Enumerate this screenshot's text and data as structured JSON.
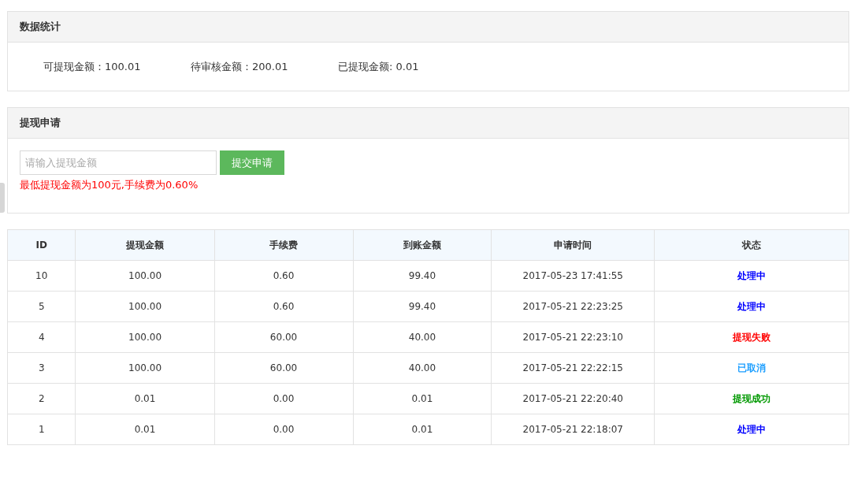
{
  "stats_panel": {
    "title": "数据统计",
    "items": [
      {
        "label": "可提现金额：100.01"
      },
      {
        "label": "待审核金额：200.01"
      },
      {
        "label": "已提现金额: 0.01"
      }
    ]
  },
  "withdraw_panel": {
    "title": "提现申请",
    "amount_field": {
      "placeholder": "请输入提现金额"
    },
    "submit_button": "提交申请",
    "notice": "最低提现金额为100元,手续费为0.60%"
  },
  "table": {
    "columns": [
      "ID",
      "提现金额",
      "手续费",
      "到账金额",
      "申请时间",
      "状态"
    ],
    "rows": [
      {
        "cells": [
          "10",
          "100.00",
          "0.60",
          "99.40",
          "2017-05-23 17:41:55"
        ],
        "status": "处理中",
        "color": "#0000ff"
      },
      {
        "cells": [
          "5",
          "100.00",
          "0.60",
          "99.40",
          "2017-05-21 22:23:25"
        ],
        "status": "处理中",
        "color": "#0000ff"
      },
      {
        "cells": [
          "4",
          "100.00",
          "60.00",
          "40.00",
          "2017-05-21 22:23:10"
        ],
        "status": "提现失败",
        "color": "#ff0000"
      },
      {
        "cells": [
          "3",
          "100.00",
          "60.00",
          "40.00",
          "2017-05-21 22:22:15"
        ],
        "status": "已取消",
        "color": "#1e9fff"
      },
      {
        "cells": [
          "2",
          "0.01",
          "0.00",
          "0.01",
          "2017-05-21 22:20:40"
        ],
        "status": "提现成功",
        "color": "#009900"
      },
      {
        "cells": [
          "1",
          "0.01",
          "0.00",
          "0.01",
          "2017-05-21 22:18:07"
        ],
        "status": "处理中",
        "color": "#0000ff"
      }
    ]
  }
}
